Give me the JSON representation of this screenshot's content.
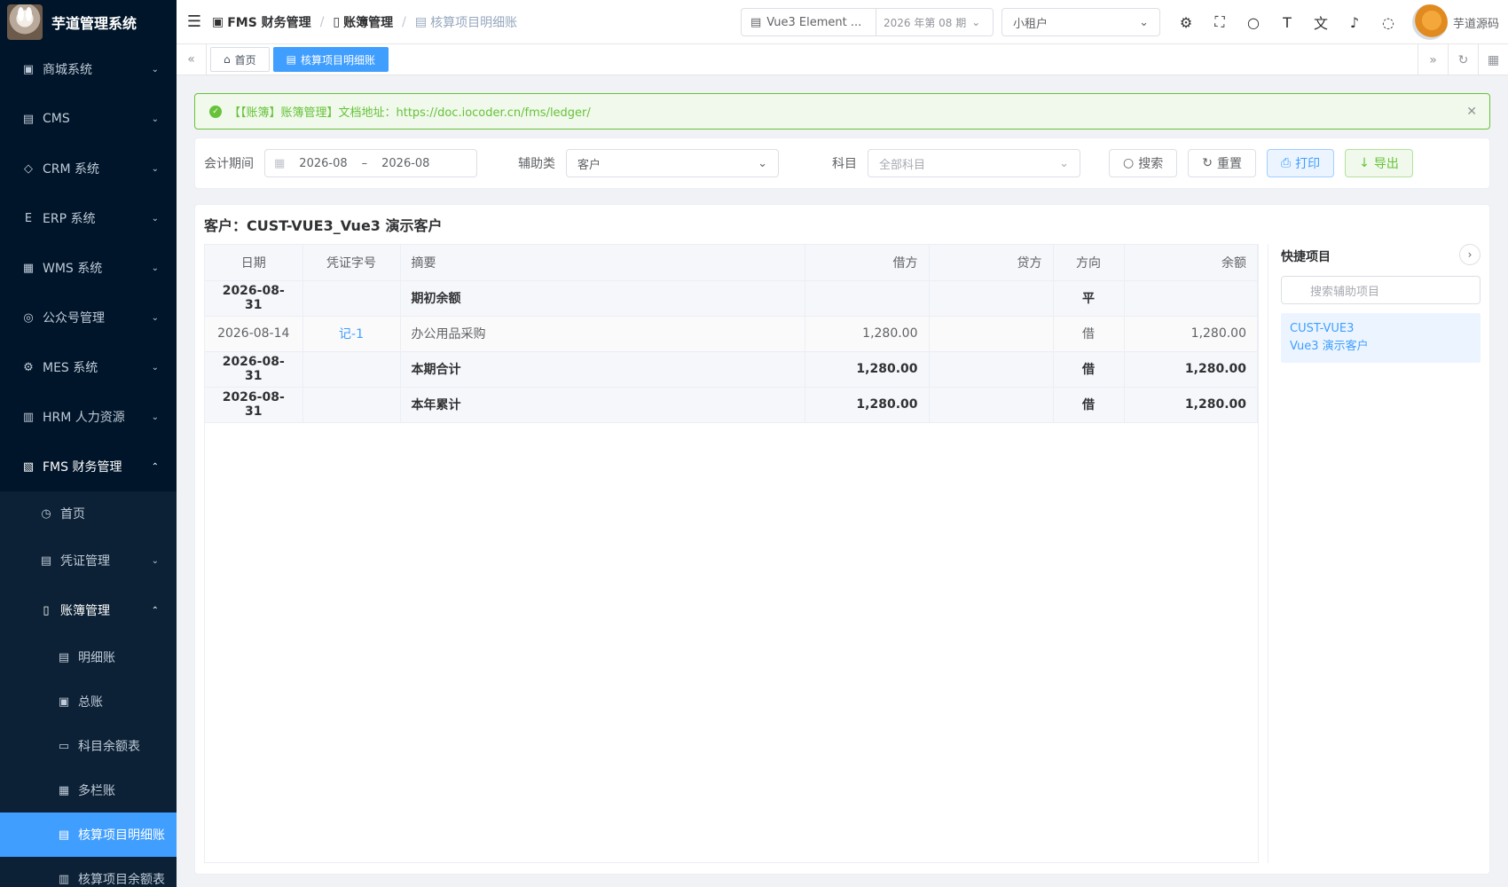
{
  "app": {
    "title": "芋道管理系统"
  },
  "sidebar": {
    "items": [
      {
        "label": "商城系统",
        "icon": "▣"
      },
      {
        "label": "CMS",
        "icon": "▤"
      },
      {
        "label": "CRM 系统",
        "icon": "◇"
      },
      {
        "label": "ERP 系统",
        "icon": "E"
      },
      {
        "label": "WMS 系统",
        "icon": "▦"
      },
      {
        "label": "公众号管理",
        "icon": "◎"
      },
      {
        "label": "MES 系统",
        "icon": "⚙"
      },
      {
        "label": "HRM 人力资源",
        "icon": "▥"
      },
      {
        "label": "FMS 财务管理",
        "icon": "▧"
      }
    ],
    "fms_sub": [
      {
        "label": "首页"
      },
      {
        "label": "凭证管理"
      },
      {
        "label": "账簿管理"
      }
    ],
    "ledger_sub": [
      {
        "label": "明细账"
      },
      {
        "label": "总账"
      },
      {
        "label": "科目余额表"
      },
      {
        "label": "多栏账"
      },
      {
        "label": "核算项目明细账"
      },
      {
        "label": "核算项目余额表"
      }
    ]
  },
  "header": {
    "breadcrumb": [
      "FMS 财务管理",
      "账簿管理",
      "核算项目明细账"
    ],
    "book_name": "Vue3 Element ...",
    "book_period": "2026 年第 08 期",
    "tenant": "小租户",
    "user_name": "芋道源码"
  },
  "tags": {
    "home": "首页",
    "current": "核算项目明细账"
  },
  "alert": {
    "text": "【【账簿】账簿管理】文档地址：https://doc.iocoder.cn/fms/ledger/"
  },
  "search": {
    "period_label": "会计期间",
    "period_start": "2026-08",
    "period_sep": "–",
    "period_end": "2026-08",
    "aux_label": "辅助类",
    "aux_value": "客户",
    "subject_label": "科目",
    "subject_placeholder": "全部科目",
    "btn_search": "搜索",
    "btn_reset": "重置",
    "btn_print": "打印",
    "btn_export": "导出"
  },
  "content": {
    "customer_title": "客户：CUST-VUE3_Vue3 演示客户",
    "columns": [
      "日期",
      "凭证字号",
      "摘要",
      "借方",
      "贷方",
      "方向",
      "余额"
    ],
    "rows": [
      {
        "date": "2026-08-31",
        "voucher": "",
        "summary": "期初余额",
        "debit": "",
        "credit": "",
        "dir": "平",
        "balance": "",
        "bold": true
      },
      {
        "date": "2026-08-14",
        "voucher": "记-1",
        "summary": "办公用品采购",
        "debit": "1,280.00",
        "credit": "",
        "dir": "借",
        "balance": "1,280.00",
        "bold": false
      },
      {
        "date": "2026-08-31",
        "voucher": "",
        "summary": "本期合计",
        "debit": "1,280.00",
        "credit": "",
        "dir": "借",
        "balance": "1,280.00",
        "bold": true
      },
      {
        "date": "2026-08-31",
        "voucher": "",
        "summary": "本年累计",
        "debit": "1,280.00",
        "credit": "",
        "dir": "借",
        "balance": "1,280.00",
        "bold": true
      }
    ]
  },
  "quick": {
    "title": "快捷项目",
    "search_placeholder": "搜索辅助项目",
    "item_code": "CUST-VUE3",
    "item_name": "Vue3 演示客户"
  }
}
